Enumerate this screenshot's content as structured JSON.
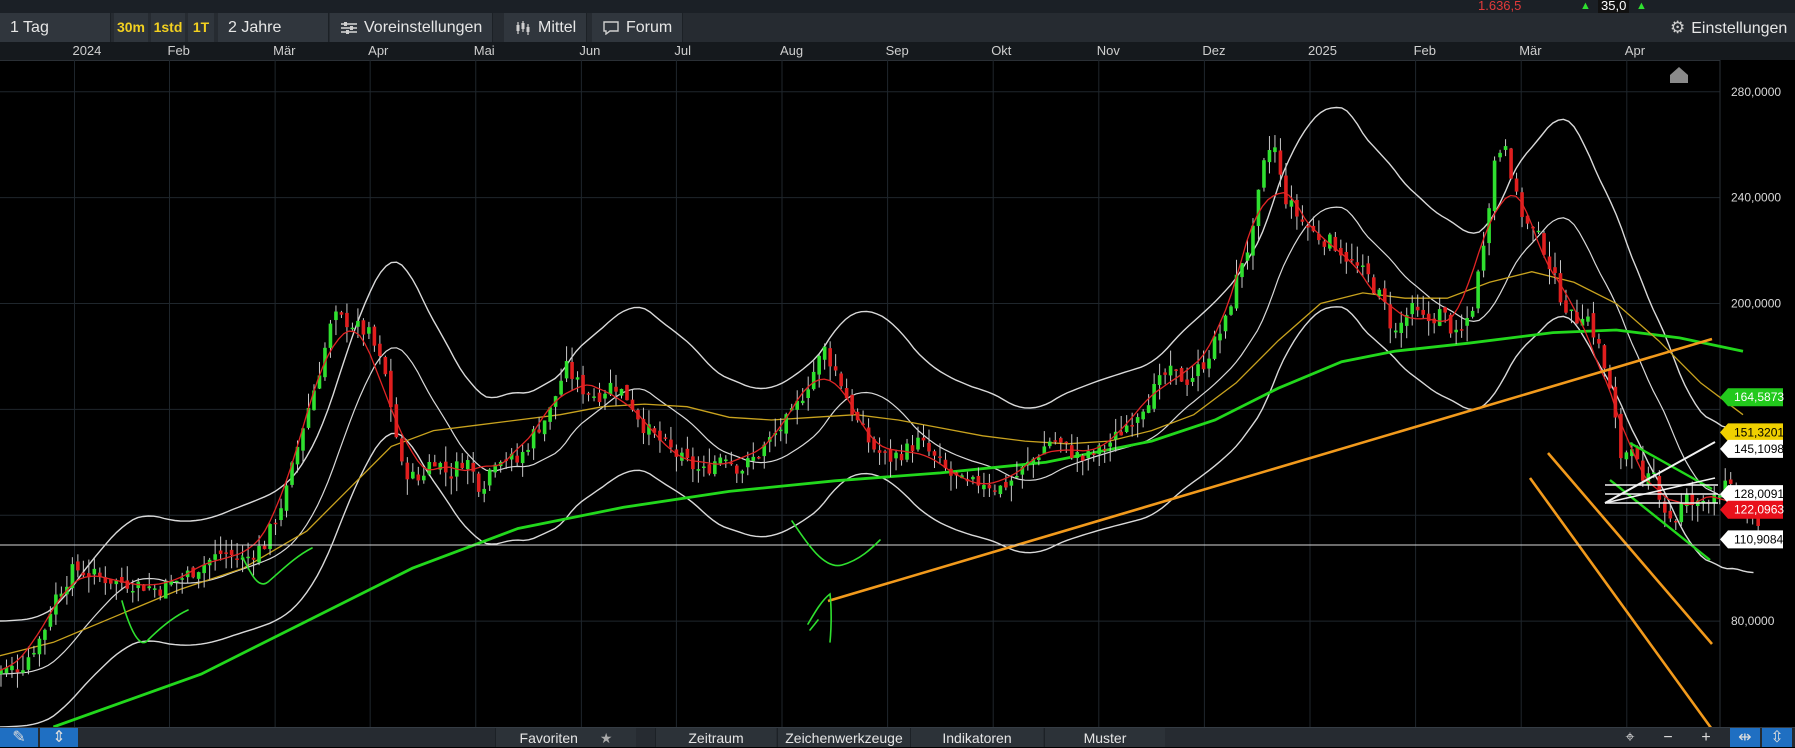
{
  "header": {
    "quote_value": "1.636,5",
    "quote_change": "35,0",
    "range_label": "1 Tag",
    "periods": [
      "30m",
      "1std",
      "1T"
    ],
    "timespan": "2 Jahre",
    "presets_label": "Voreinstellungen",
    "chart_type_label": "Mittel",
    "forum_label": "Forum",
    "settings_label": "Einstellungen"
  },
  "bottom": {
    "tabs": [
      "Favoriten",
      "Zeitraum",
      "Zeichenwerkzeuge",
      "Indikatoren",
      "Muster"
    ],
    "zoom_out": "−",
    "zoom_in": "+"
  },
  "colors": {
    "bull": "#2fe02f",
    "bear": "#e01e1e",
    "bollinger": "#d9d9d9",
    "ma_short": "#e12525",
    "ma_mid": "#c8a21e",
    "ma_long": "#22d81c",
    "trend": "#f29a1c",
    "annotation": "#2fe02f",
    "price_flag": "#e8101b"
  },
  "chart_data": {
    "type": "line",
    "x_axis": {
      "ticks": [
        "2024",
        "Feb",
        "Mär",
        "Apr",
        "Mai",
        "Jun",
        "Jul",
        "Aug",
        "Sep",
        "Okt",
        "Nov",
        "Dez",
        "2025",
        "Feb",
        "Mär",
        "Apr"
      ],
      "positions": [
        0.8,
        1.7,
        2.7,
        3.6,
        4.6,
        5.6,
        6.5,
        7.5,
        8.5,
        9.5,
        10.5,
        11.5,
        12.5,
        13.5,
        14.5,
        15.5
      ]
    },
    "y_axis": {
      "ticks": [
        "80,0000",
        "200,0000",
        "240,0000",
        "280,0000"
      ],
      "tick_values": [
        80,
        200,
        240,
        280
      ],
      "ylim": [
        40,
        292
      ]
    },
    "price_tags": [
      {
        "text": "164,5873",
        "value": 164.6,
        "bg": "#22c91c",
        "fg": "#ffffff"
      },
      {
        "text": "151,3201",
        "value": 151.3,
        "bg": "#f0d000",
        "fg": "#000000"
      },
      {
        "text": "145,1098",
        "value": 145.1,
        "bg": "#ffffff",
        "fg": "#000000"
      },
      {
        "text": "128,0091",
        "value": 128.0,
        "bg": "#ffffff",
        "fg": "#000000"
      },
      {
        "text": "122,0963",
        "value": 122.1,
        "bg": "#e8101b",
        "fg": "#ffffff"
      },
      {
        "text": "110,9084",
        "value": 110.9,
        "bg": "#ffffff",
        "fg": "#000000"
      }
    ],
    "price": [
      [
        0.0,
        60
      ],
      [
        0.3,
        63
      ],
      [
        0.5,
        75
      ],
      [
        0.6,
        88
      ],
      [
        0.8,
        100
      ],
      [
        1.0,
        97
      ],
      [
        1.2,
        95
      ],
      [
        1.4,
        94
      ],
      [
        1.6,
        92
      ],
      [
        1.8,
        96
      ],
      [
        2.0,
        101
      ],
      [
        2.2,
        106
      ],
      [
        2.4,
        103
      ],
      [
        2.6,
        109
      ],
      [
        2.8,
        128
      ],
      [
        2.95,
        152
      ],
      [
        3.1,
        172
      ],
      [
        3.25,
        195
      ],
      [
        3.4,
        193
      ],
      [
        3.6,
        188
      ],
      [
        3.75,
        172
      ],
      [
        3.9,
        138
      ],
      [
        4.05,
        133
      ],
      [
        4.2,
        142
      ],
      [
        4.35,
        135
      ],
      [
        4.5,
        142
      ],
      [
        4.65,
        130
      ],
      [
        4.8,
        143
      ],
      [
        5.0,
        140
      ],
      [
        5.15,
        151
      ],
      [
        5.3,
        159
      ],
      [
        5.45,
        176
      ],
      [
        5.6,
        168
      ],
      [
        5.75,
        165
      ],
      [
        5.9,
        170
      ],
      [
        6.05,
        164
      ],
      [
        6.2,
        153
      ],
      [
        6.35,
        148
      ],
      [
        6.55,
        141
      ],
      [
        6.75,
        136
      ],
      [
        6.95,
        144
      ],
      [
        7.1,
        137
      ],
      [
        7.25,
        142
      ],
      [
        7.4,
        149
      ],
      [
        7.6,
        158
      ],
      [
        7.75,
        170
      ],
      [
        7.9,
        183
      ],
      [
        8.05,
        171
      ],
      [
        8.2,
        156
      ],
      [
        8.35,
        146
      ],
      [
        8.5,
        141
      ],
      [
        8.65,
        144
      ],
      [
        8.8,
        148
      ],
      [
        8.95,
        141
      ],
      [
        9.1,
        135
      ],
      [
        9.25,
        131
      ],
      [
        9.4,
        133
      ],
      [
        9.55,
        130
      ],
      [
        9.7,
        134
      ],
      [
        9.9,
        142
      ],
      [
        10.05,
        149
      ],
      [
        10.2,
        145
      ],
      [
        10.35,
        141
      ],
      [
        10.5,
        144
      ],
      [
        10.65,
        149
      ],
      [
        10.85,
        158
      ],
      [
        11.0,
        166
      ],
      [
        11.15,
        174
      ],
      [
        11.35,
        171
      ],
      [
        11.5,
        178
      ],
      [
        11.7,
        193
      ],
      [
        11.85,
        216
      ],
      [
        11.95,
        224
      ],
      [
        12.05,
        250
      ],
      [
        12.15,
        262
      ],
      [
        12.25,
        241
      ],
      [
        12.4,
        232
      ],
      [
        12.55,
        226
      ],
      [
        12.75,
        222
      ],
      [
        12.9,
        215
      ],
      [
        13.05,
        210
      ],
      [
        13.2,
        200
      ],
      [
        13.3,
        188
      ],
      [
        13.45,
        198
      ],
      [
        13.6,
        193
      ],
      [
        13.75,
        197
      ],
      [
        13.9,
        186
      ],
      [
        14.05,
        200
      ],
      [
        14.15,
        226
      ],
      [
        14.25,
        254
      ],
      [
        14.35,
        262
      ],
      [
        14.45,
        240
      ],
      [
        14.55,
        230
      ],
      [
        14.7,
        223
      ],
      [
        14.85,
        205
      ],
      [
        15.0,
        193
      ],
      [
        15.1,
        198
      ],
      [
        15.25,
        182
      ],
      [
        15.35,
        165
      ],
      [
        15.45,
        141
      ],
      [
        15.55,
        148
      ],
      [
        15.65,
        130
      ],
      [
        15.75,
        136
      ],
      [
        15.85,
        123
      ],
      [
        15.95,
        117
      ],
      [
        16.05,
        127
      ],
      [
        16.15,
        123
      ],
      [
        16.3,
        128
      ],
      [
        16.45,
        131
      ],
      [
        16.6,
        122
      ],
      [
        16.75,
        114
      ]
    ],
    "series": [
      {
        "key": "ma_long",
        "points": [
          [
            0.6,
            40
          ],
          [
            2.0,
            60
          ],
          [
            3.0,
            80
          ],
          [
            4.0,
            100
          ],
          [
            5.0,
            115
          ],
          [
            6.0,
            123
          ],
          [
            7.0,
            129
          ],
          [
            8.0,
            133
          ],
          [
            9.0,
            136
          ],
          [
            10.0,
            140
          ],
          [
            11.0,
            148
          ],
          [
            11.6,
            156
          ],
          [
            12.2,
            168
          ],
          [
            12.8,
            178
          ],
          [
            13.3,
            182
          ],
          [
            14.0,
            185
          ],
          [
            14.8,
            189
          ],
          [
            15.4,
            190
          ],
          [
            16.0,
            187
          ],
          [
            16.6,
            182
          ]
        ]
      },
      {
        "key": "ma_mid",
        "points": [
          [
            0.0,
            66
          ],
          [
            0.6,
            72
          ],
          [
            1.2,
            82
          ],
          [
            1.8,
            92
          ],
          [
            2.4,
            100
          ],
          [
            3.0,
            114
          ],
          [
            3.4,
            130
          ],
          [
            3.8,
            146
          ],
          [
            4.2,
            152
          ],
          [
            4.6,
            154
          ],
          [
            5.0,
            156
          ],
          [
            5.4,
            158
          ],
          [
            5.8,
            161
          ],
          [
            6.2,
            162
          ],
          [
            6.6,
            161
          ],
          [
            7.0,
            157
          ],
          [
            7.4,
            156
          ],
          [
            7.8,
            157
          ],
          [
            8.2,
            158
          ],
          [
            8.6,
            156
          ],
          [
            9.0,
            153
          ],
          [
            9.4,
            150
          ],
          [
            9.8,
            148
          ],
          [
            10.2,
            147
          ],
          [
            10.6,
            148
          ],
          [
            11.0,
            152
          ],
          [
            11.4,
            158
          ],
          [
            11.8,
            170
          ],
          [
            12.2,
            186
          ],
          [
            12.6,
            200
          ],
          [
            13.0,
            204
          ],
          [
            13.4,
            202
          ],
          [
            13.8,
            202
          ],
          [
            14.2,
            208
          ],
          [
            14.6,
            212
          ],
          [
            15.0,
            208
          ],
          [
            15.4,
            200
          ],
          [
            15.8,
            186
          ],
          [
            16.2,
            170
          ],
          [
            16.6,
            158
          ]
        ]
      }
    ]
  }
}
